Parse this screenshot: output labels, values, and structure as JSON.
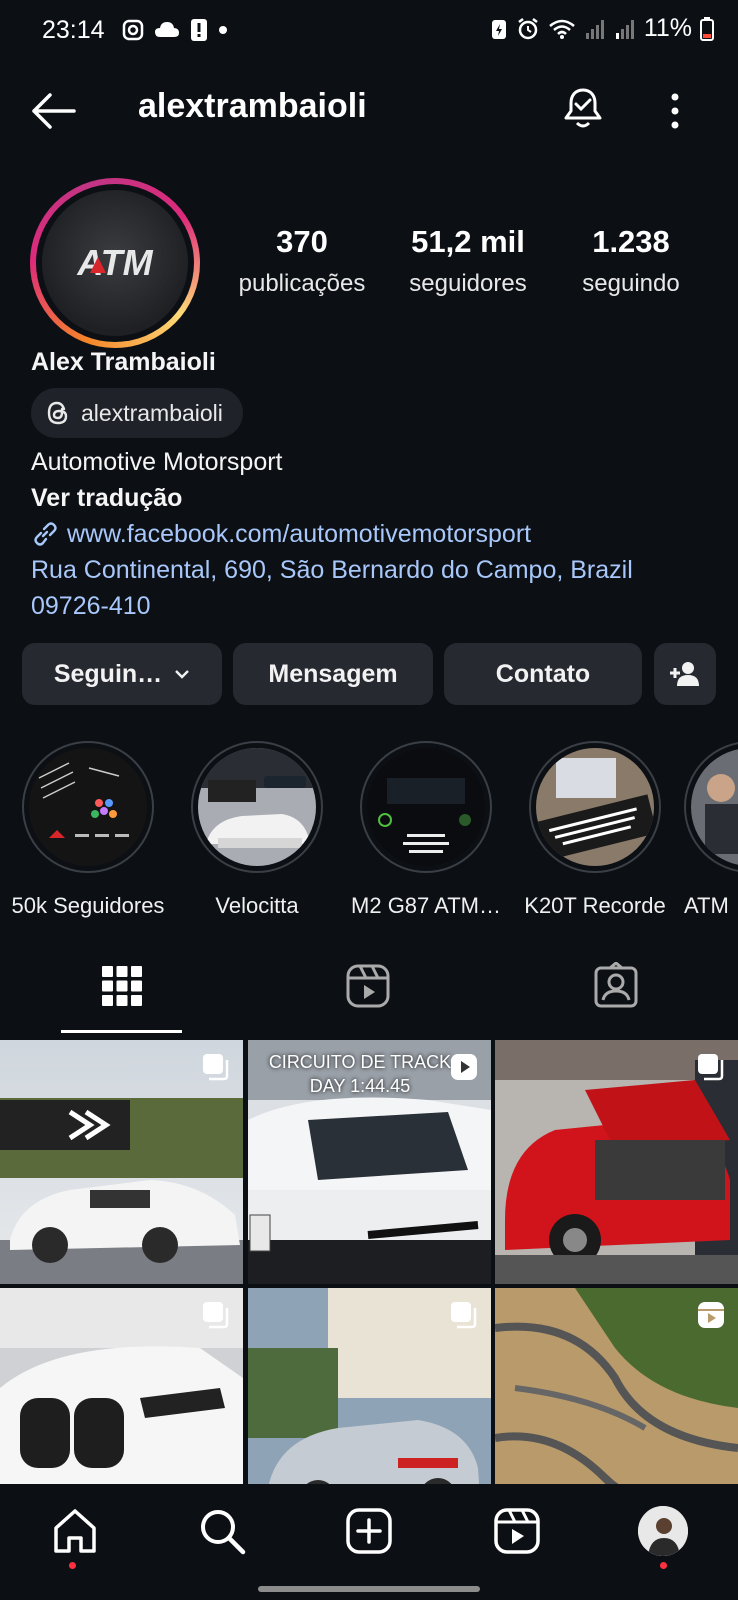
{
  "status_bar": {
    "time": "23:14",
    "battery": "11%"
  },
  "header": {
    "username": "alextrambaioli"
  },
  "profile": {
    "logo_text": "ATM",
    "stats": [
      {
        "value": "370",
        "label": "publicações"
      },
      {
        "value": "51,2 mil",
        "label": "seguidores"
      },
      {
        "value": "1.238",
        "label": "seguindo"
      }
    ],
    "full_name": "Alex Trambaioli",
    "threads_handle": "alextrambaioli",
    "category": "Automotive Motorsport",
    "translate": "Ver tradução",
    "link": "www.facebook.com/automotivemotorsport",
    "address_line1": "Rua Continental, 690, São Bernardo do Campo, Brazil",
    "address_line2": "09726-410"
  },
  "actions": {
    "following": "Seguin…",
    "message": "Mensagem",
    "contact": "Contato"
  },
  "highlights": [
    {
      "label": "50k Seguidores"
    },
    {
      "label": "Velocitta"
    },
    {
      "label": "M2 G87 ATM…"
    },
    {
      "label": "K20T Recorde"
    },
    {
      "label": "ATM"
    }
  ],
  "posts": [
    {
      "caption": ""
    },
    {
      "caption": "CIRCUITO DE TRACK DAY 1:44.45"
    },
    {
      "caption": ""
    },
    {
      "caption": ""
    },
    {
      "caption": ""
    },
    {
      "caption": ""
    }
  ],
  "colors": {
    "background": "#0c1015",
    "button": "#262a30",
    "link": "#a8c7fa",
    "notification": "#ff3040"
  }
}
